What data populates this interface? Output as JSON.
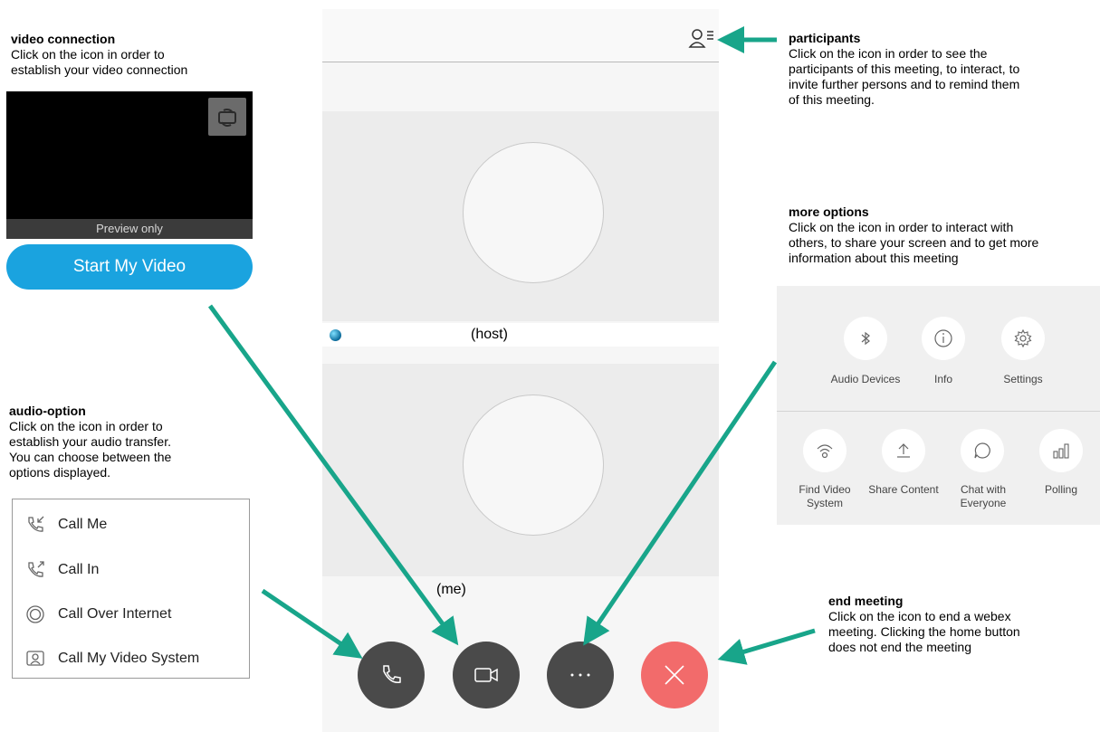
{
  "annotations": {
    "video": {
      "title": "video connection",
      "body_line1": "Click on the icon in order to",
      "body_line2": "establish your video connection"
    },
    "participants": {
      "title": "participants",
      "body_line1": "Click on the icon in order to see the",
      "body_line2": "participants of this meeting, to interact, to",
      "body_line3": "invite further persons and to remind them",
      "body_line4": "of this meeting."
    },
    "more": {
      "title": "more options",
      "body_line1": "Click on the icon in order to interact with",
      "body_line2": "others, to share your screen and to get more",
      "body_line3": "information about this meeting"
    },
    "audio": {
      "title": "audio-option",
      "body_line1": "Click on the icon in order to",
      "body_line2": "establish your audio transfer.",
      "body_line3": "You can choose between the",
      "body_line4": "options displayed."
    },
    "end": {
      "title": "end meeting",
      "body_line1": "Click on the icon to end a webex",
      "body_line2": "meeting. Clicking the home button",
      "body_line3": "does not end the meeting"
    }
  },
  "video_preview": {
    "preview_label": "Preview only",
    "start_button": "Start My Video"
  },
  "audio_options": [
    "Call Me",
    "Call In",
    "Call Over Internet",
    "Call My Video System"
  ],
  "meeting": {
    "host_label": "(host)",
    "me_label": "(me)"
  },
  "more_options": {
    "row1": [
      "Audio Devices",
      "Info",
      "Settings"
    ],
    "row2": [
      "Find Video System",
      "Share Content",
      "Chat with Everyone",
      "Polling"
    ]
  },
  "colors": {
    "accent_arrow": "#18a58a",
    "start_button": "#1aa3df",
    "end_button": "#f26b6b",
    "control_button": "#4a4a4a"
  },
  "icons": {
    "participants": "participants-list-icon",
    "camera_switch": "camera-switch-icon",
    "phone": "phone-icon",
    "video": "video-camera-icon",
    "more": "more-dots-icon",
    "end": "close-x-icon"
  }
}
